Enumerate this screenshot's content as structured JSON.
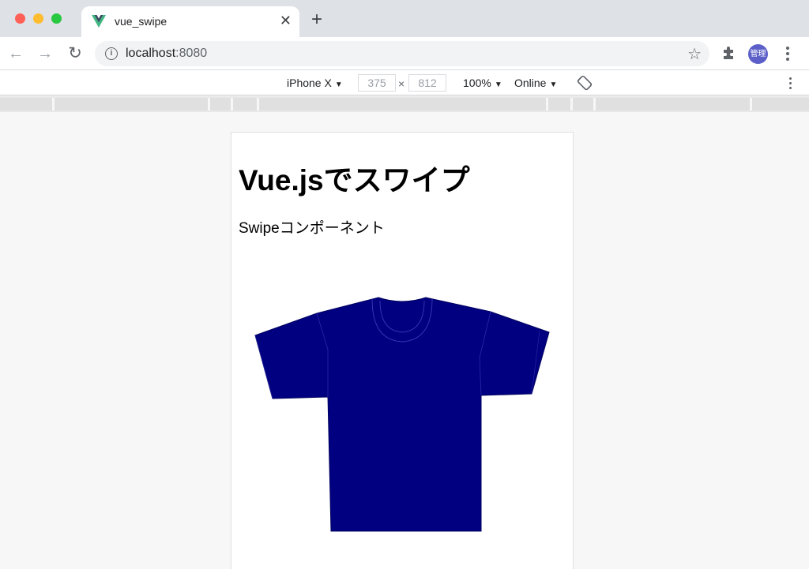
{
  "browser": {
    "tab_title": "vue_swipe",
    "url_host": "localhost",
    "url_port": ":8080",
    "profile_label": "管理",
    "icons": [
      "vue-logo-icon",
      "close-icon",
      "plus-icon",
      "back-arrow-icon",
      "forward-arrow-icon",
      "reload-icon",
      "info-icon",
      "star-icon",
      "puzzle-icon",
      "more-vert-icon"
    ]
  },
  "device_toolbar": {
    "device": "iPhone X",
    "width": "375",
    "height": "812",
    "times": "×",
    "zoom": "100%",
    "network": "Online"
  },
  "page": {
    "title": "Vue.jsでスワイプ",
    "subtitle": "Swipeコンポーネント",
    "image": "navy-tshirt",
    "shirt_color": "#000080"
  }
}
